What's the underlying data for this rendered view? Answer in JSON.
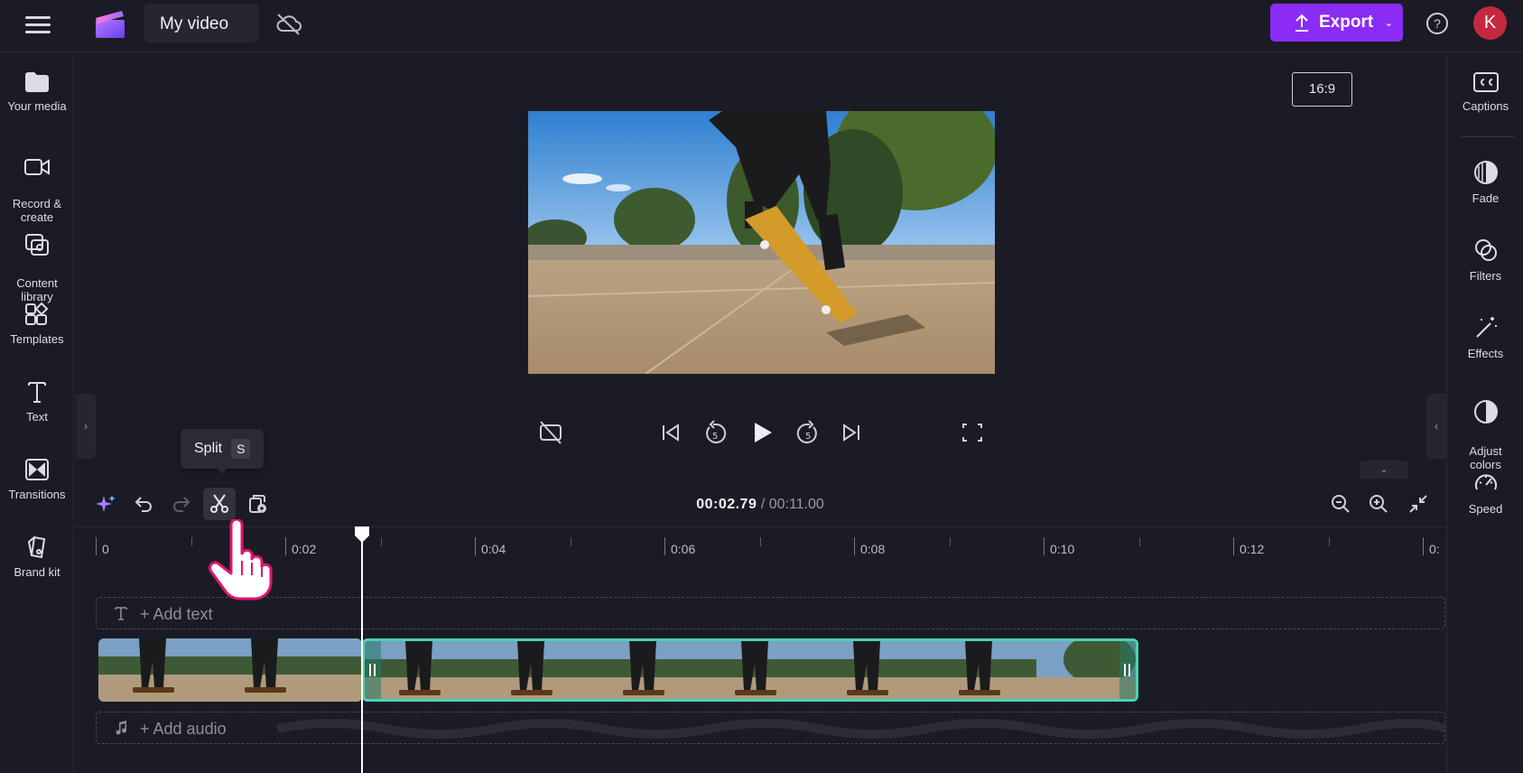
{
  "app": {
    "project_name": "My video",
    "export_label": "Export",
    "avatar_initial": "K",
    "help_glyph": "?"
  },
  "colors": {
    "accent": "#8b2cf5",
    "selected_clip_border": "#48d5b4",
    "avatar": "#c4293f",
    "background": "#1b1b25"
  },
  "left_sidebar": {
    "items": [
      {
        "label": "Your media",
        "icon": "folder-icon"
      },
      {
        "label": "Record &\ncreate",
        "icon": "video-camera-icon"
      },
      {
        "label": "Content\nlibrary",
        "icon": "content-library-icon"
      },
      {
        "label": "Templates",
        "icon": "templates-icon"
      },
      {
        "label": "Text",
        "icon": "text-icon"
      },
      {
        "label": "Transitions",
        "icon": "transitions-icon"
      },
      {
        "label": "Brand kit",
        "icon": "brand-kit-icon"
      }
    ]
  },
  "right_sidebar": {
    "items": [
      {
        "label": "Captions",
        "icon": "captions-icon"
      },
      {
        "label": "Fade",
        "icon": "fade-icon"
      },
      {
        "label": "Filters",
        "icon": "filters-icon"
      },
      {
        "label": "Effects",
        "icon": "effects-wand-icon"
      },
      {
        "label": "Adjust\ncolors",
        "icon": "adjust-colors-icon"
      },
      {
        "label": "Speed",
        "icon": "speed-icon"
      }
    ]
  },
  "preview": {
    "aspect_ratio": "16:9"
  },
  "timeline": {
    "current_time": "00:02.79",
    "total_time": "/ 00:11.00",
    "tooltip_label": "Split",
    "tooltip_key": "S",
    "ruler_labels": [
      "0",
      "0:02",
      "0:04",
      "0:06",
      "0:08",
      "0:10",
      "0:12",
      "0:"
    ],
    "add_text_label": "+ Add text",
    "add_audio_label": "+ Add audio"
  }
}
